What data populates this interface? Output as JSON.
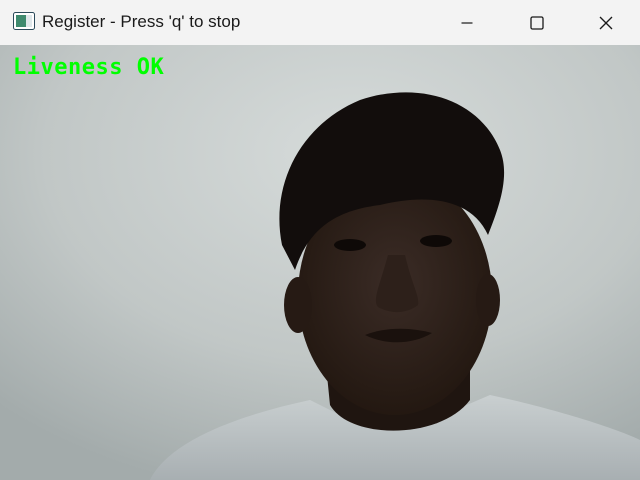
{
  "window": {
    "title": "Register - Press 'q' to stop",
    "app_icon": "opencv-window-icon",
    "controls": {
      "minimize_icon": "minimize-icon",
      "maximize_icon": "maximize-icon",
      "close_icon": "close-icon"
    }
  },
  "video": {
    "overlay_text": "Liveness OK",
    "overlay_color": "#00ff00",
    "content": "webcam-frame"
  }
}
